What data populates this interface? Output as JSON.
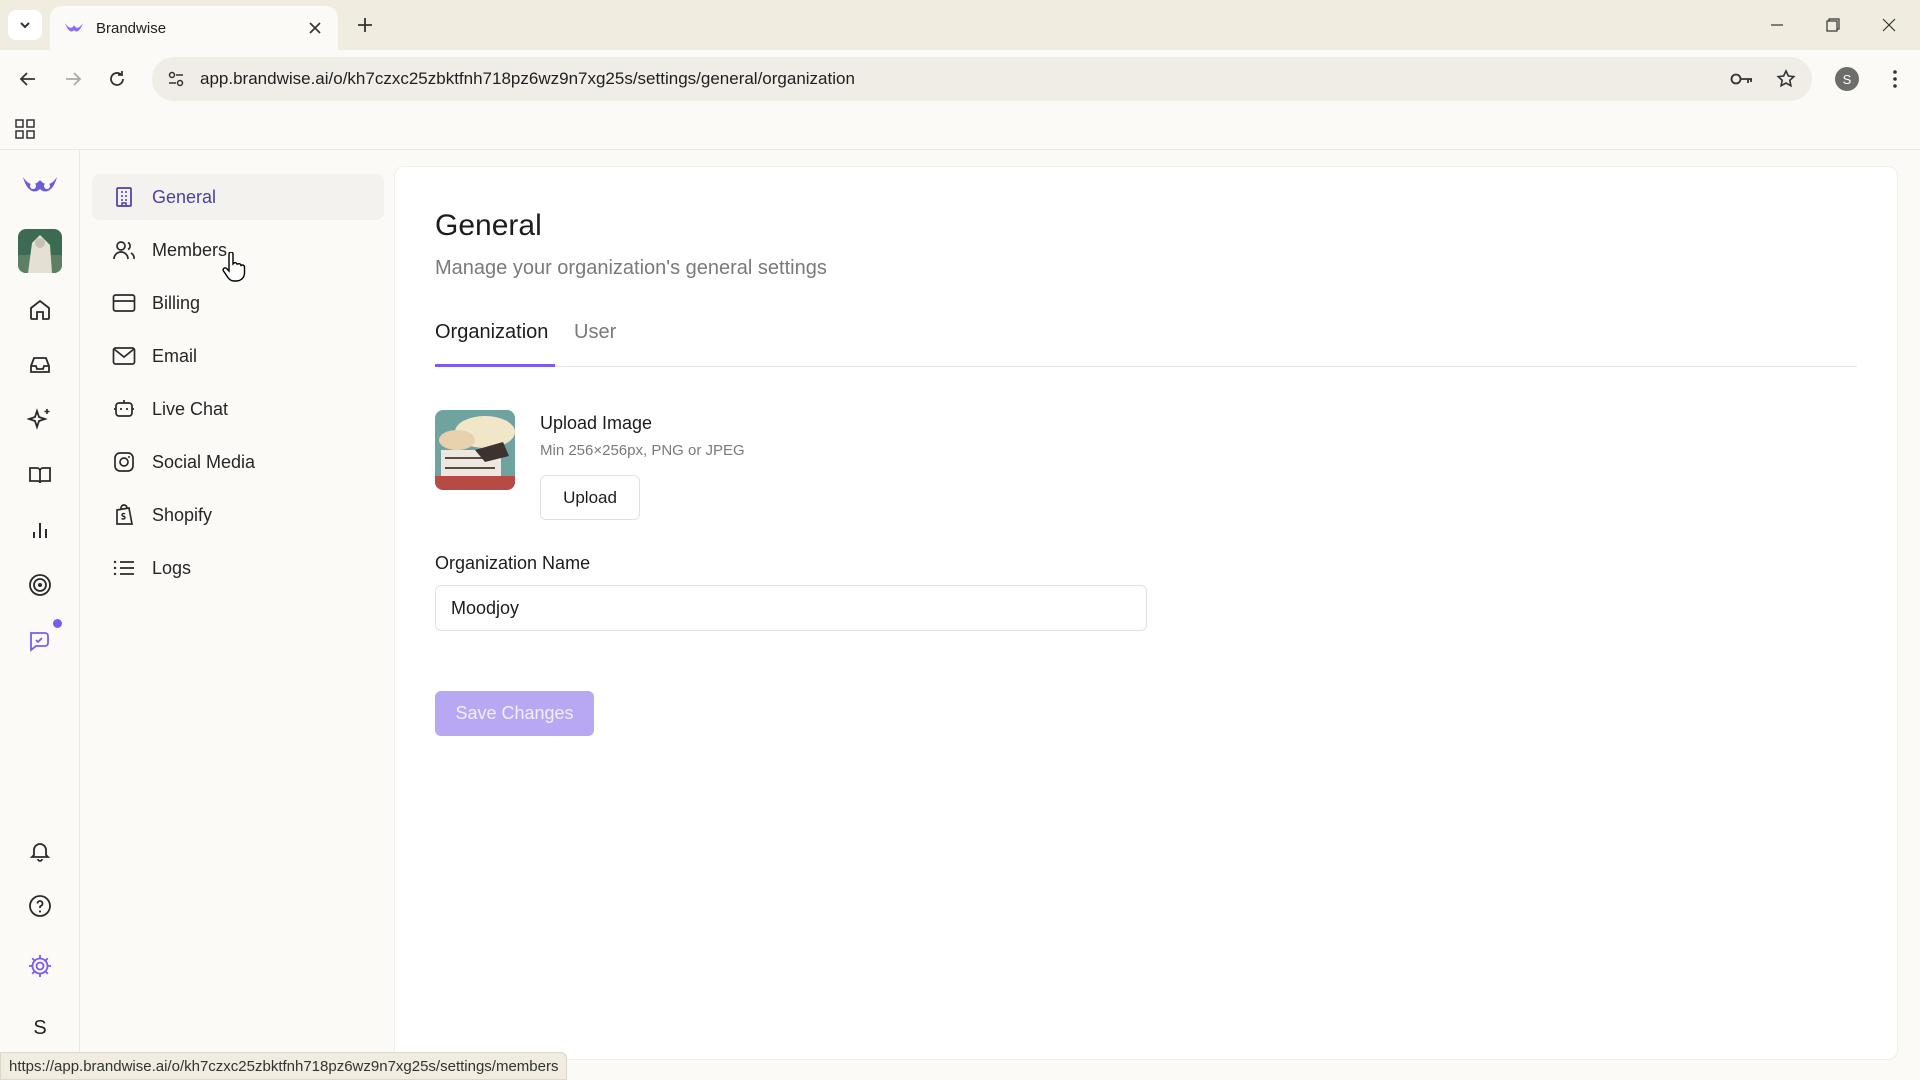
{
  "browser": {
    "tab_title": "Brandwise",
    "url": "app.brandwise.ai/o/kh7czxc25zbktfnh718pz6wz9n7xg25s/settings/general/organization",
    "profile_initial": "S",
    "status_url": "https://app.brandwise.ai/o/kh7czxc25zbktfnh718pz6wz9n7xg25s/settings/members"
  },
  "rail": {
    "user_initial": "S",
    "icons": [
      "owl-logo-icon",
      "workspace-avatar",
      "home-icon",
      "inbox-icon",
      "sparkles-icon",
      "book-icon",
      "bar-chart-icon",
      "target-icon",
      "chat-bot-icon",
      "bell-icon",
      "help-icon",
      "settings-icon"
    ]
  },
  "settings_nav": {
    "items": [
      {
        "label": "General",
        "icon": "building-icon"
      },
      {
        "label": "Members",
        "icon": "users-icon"
      },
      {
        "label": "Billing",
        "icon": "credit-card-icon"
      },
      {
        "label": "Email",
        "icon": "mail-icon"
      },
      {
        "label": "Live Chat",
        "icon": "bot-icon"
      },
      {
        "label": "Social Media",
        "icon": "instagram-icon"
      },
      {
        "label": "Shopify",
        "icon": "shopify-icon"
      },
      {
        "label": "Logs",
        "icon": "list-icon"
      }
    ]
  },
  "main": {
    "title": "General",
    "subtitle": "Manage your organization's general settings",
    "tabs": [
      {
        "label": "Organization",
        "active": true
      },
      {
        "label": "User",
        "active": false
      }
    ],
    "upload": {
      "title": "Upload Image",
      "hint": "Min 256×256px, PNG or JPEG",
      "button": "Upload"
    },
    "org_name": {
      "label": "Organization Name",
      "value": "Moodjoy"
    },
    "save_button": "Save Changes"
  },
  "colors": {
    "accent": "#7c5cf0",
    "save_disabled": "#b8a8f3"
  }
}
